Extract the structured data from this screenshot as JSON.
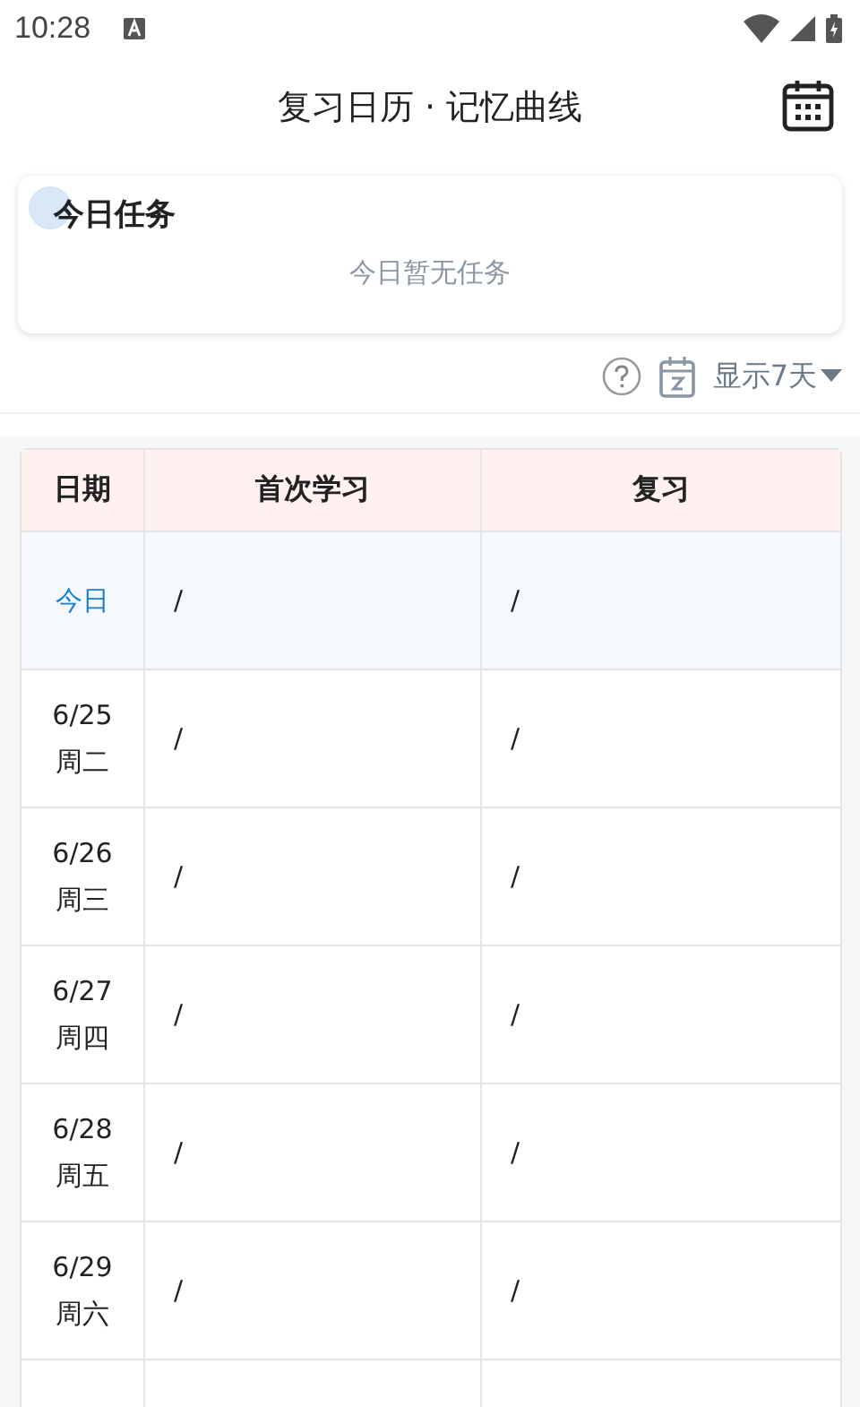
{
  "status_bar": {
    "time": "10:28"
  },
  "header": {
    "title": "复习日历 · 记忆曲线"
  },
  "today_card": {
    "title": "今日任务",
    "empty_text": "今日暂无任务"
  },
  "toolbar": {
    "range": "显示7天"
  },
  "table": {
    "columns": [
      "日期",
      "首次学习",
      "复习"
    ],
    "rows": [
      {
        "date": "今日",
        "weekday": "",
        "first_study": "/",
        "review": "/",
        "selected": true
      },
      {
        "date": "6/25",
        "weekday": "周二",
        "first_study": "/",
        "review": "/",
        "selected": false
      },
      {
        "date": "6/26",
        "weekday": "周三",
        "first_study": "/",
        "review": "/",
        "selected": false
      },
      {
        "date": "6/27",
        "weekday": "周四",
        "first_study": "/",
        "review": "/",
        "selected": false
      },
      {
        "date": "6/28",
        "weekday": "周五",
        "first_study": "/",
        "review": "/",
        "selected": false
      },
      {
        "date": "6/29",
        "weekday": "周六",
        "first_study": "/",
        "review": "/",
        "selected": false
      }
    ]
  }
}
